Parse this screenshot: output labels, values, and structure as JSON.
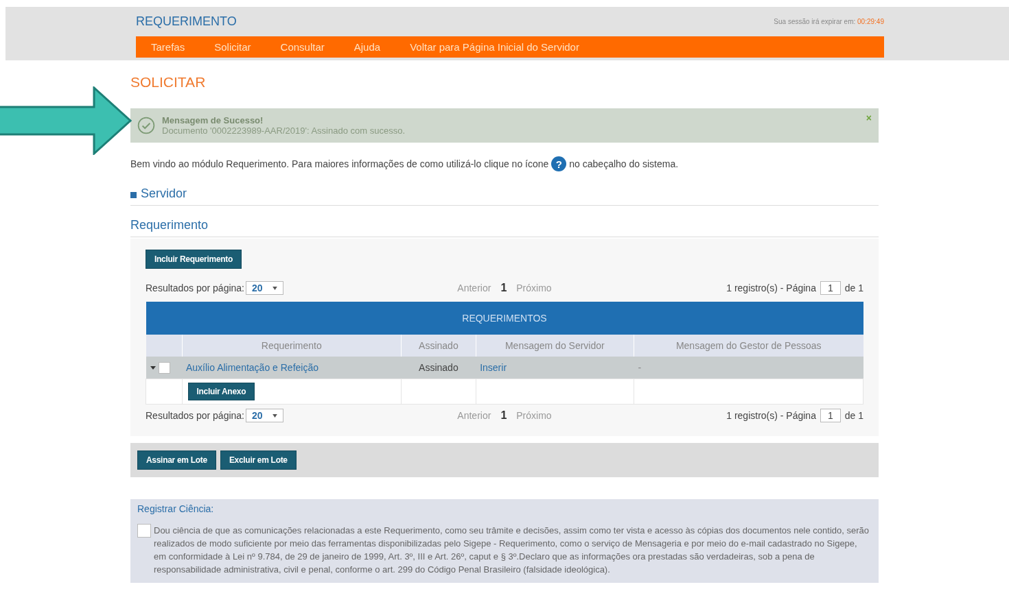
{
  "header": {
    "title": "REQUERIMENTO",
    "session_label": "Sua sessão irá expirar em:",
    "session_time": "00:29:49",
    "menu": [
      "Tarefas",
      "Solicitar",
      "Consultar",
      "Ajuda",
      "Voltar para Página Inicial do Servidor"
    ]
  },
  "page_title": "SOLICITAR",
  "alert": {
    "title": "Mensagem de Sucesso!",
    "message": "Documento '0002223989-AAR/2019': Assinado com sucesso.",
    "close": "×"
  },
  "intro": {
    "before": "Bem vindo ao módulo Requerimento. Para maiores informações de como utilizá-lo clique no ícone",
    "help": "?",
    "after": "no cabeçalho do sistema."
  },
  "sections": [
    {
      "label": "Servidor",
      "expanded": false
    },
    {
      "label": "Requerimento",
      "expanded": true
    }
  ],
  "include_button": "Incluir Requerimento",
  "pagination": [
    {
      "label": "Resultados por página:",
      "per_page": "20",
      "prev": "Anterior",
      "page": "1",
      "next": "Próximo",
      "summary": "1 registro(s) - Página",
      "page_input": "1",
      "of": "de 1"
    },
    {
      "label": "Resultados por página:",
      "per_page": "20",
      "prev": "Anterior",
      "page": "1",
      "next": "Próximo",
      "summary": "1 registro(s) - Página",
      "page_input": "1",
      "of": "de 1"
    }
  ],
  "table": {
    "title": "REQUERIMENTOS",
    "columns": [
      "Requerimento",
      "Assinado",
      "Mensagem do Servidor",
      "Mensagem do Gestor de Pessoas"
    ],
    "rows": [
      {
        "requerimento": "Auxílio Alimentação e Refeição",
        "assinado": "Assinado",
        "mensagem_servidor": "Inserir",
        "mensagem_gestor": "-",
        "selected": false,
        "expanded": true,
        "attachment_button": "Incluir Anexo"
      }
    ]
  },
  "batch_buttons": [
    "Assinar em Lote",
    "Excluir em Lote"
  ],
  "ciencia": {
    "title": "Registrar Ciência:",
    "checked": false,
    "text": "Dou ciência de que as comunicações relacionadas a este Requerimento, como seu trâmite e decisões, assim como ter vista e acesso às cópias dos documentos nele contido, serão realizados de modo suficiente por meio das ferramentas disponibilizadas pelo Sigepe - Requerimento, como o serviço de Mensageria e por meio do e-mail cadastrado no Sigepe, em conformidade à Lei nº 9.784, de 29 de janeiro de 1999, Art. 3º, III e Art. 26º, caput e § 3º.Declaro que as informações ora prestadas são verdadeiras, sob a pena de responsabilidade administrativa, civil e penal, conforme o art. 299 do Código Penal Brasileiro (falsidade ideológica)."
  }
}
